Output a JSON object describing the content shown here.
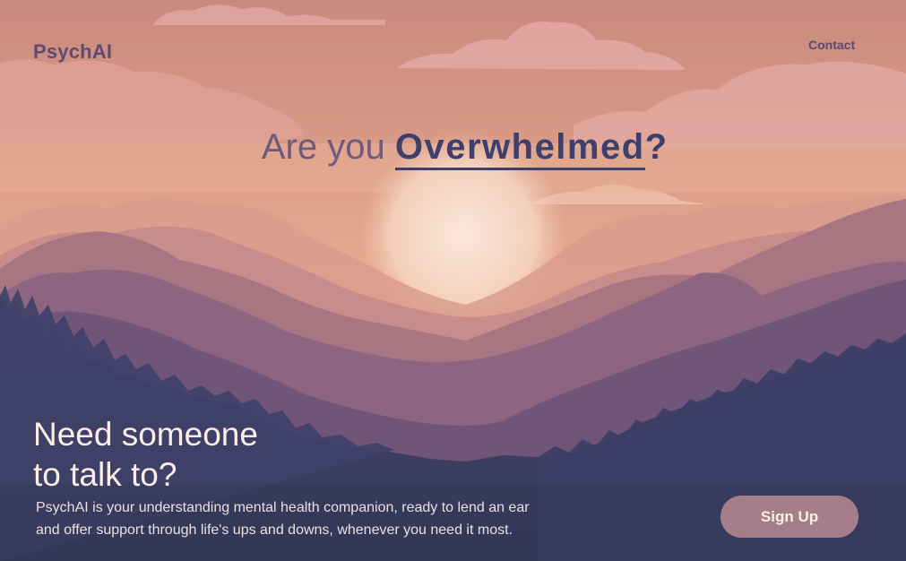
{
  "brand": {
    "logo_text": "PsychAI"
  },
  "nav": {
    "contact_label": "Contact"
  },
  "hero": {
    "headline_prefix": "Are you ",
    "headline_accent": "Overwhelmed",
    "headline_suffix": "?"
  },
  "cta": {
    "title_line1": "Need someone",
    "title_line2": "to talk to?",
    "description_line1": "PsychAI is your understanding mental health companion, ready to lend an ear",
    "description_line2": "and offer support through life's ups and downs, whenever you need it most.",
    "button_label": "Sign Up"
  },
  "colors": {
    "sky_top": "#c98a7e",
    "sky_mid": "#e9b293",
    "sun": "#f6dccd",
    "mountain_far": "#b97d88",
    "mountain_mid": "#7a5c7c",
    "mountain_near": "#3a3d63",
    "button_bg": "#a57e8a",
    "accent_text": "#3e3f6b"
  }
}
